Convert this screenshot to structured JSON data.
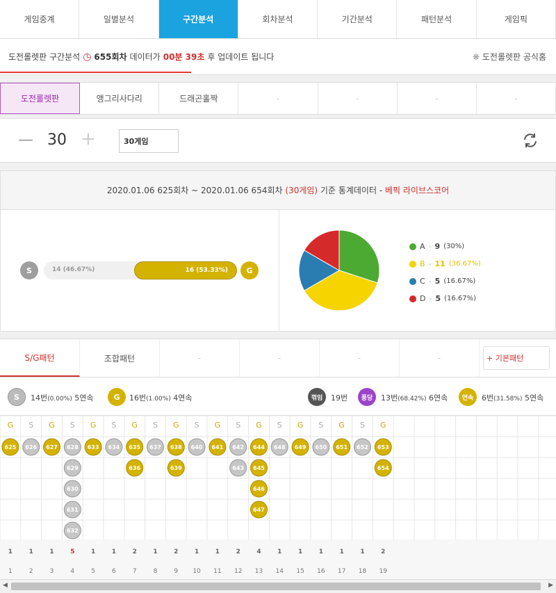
{
  "tabs": [
    "게임중계",
    "일별분석",
    "구간분석",
    "회차분석",
    "기간분석",
    "패턴분석",
    "게임픽"
  ],
  "info": {
    "prefix": "도전롤렛판 구간분석",
    "round": "655회차",
    "mid": "데이터가",
    "time": "00분 39초",
    "suffix": "후 업데이트 됩니다",
    "home": "도전롤렛판 공식홈"
  },
  "subtabs": [
    "도전롤렛판",
    "앵그리사다리",
    "드래곤홀짝",
    "-",
    "-",
    "-",
    "-"
  ],
  "control": {
    "minus": "—",
    "value": "30",
    "plus": "+",
    "select": "30게임"
  },
  "header": {
    "range": "2020.01.06 625회차 ~ 2020.01.06 654회차",
    "games": "(30게임)",
    "mid": "기준 통계데이터 -",
    "brand": "베픽 라이브스코어"
  },
  "sg": {
    "s_label": "S",
    "g_label": "G",
    "s_text": "14 (46.67%)",
    "g_text": "16 (53.33%)",
    "g_pct": 53.33
  },
  "pie": [
    {
      "name": "A",
      "count": "9",
      "pct": "(30%)",
      "value": 9,
      "color": "#4caa32"
    },
    {
      "name": "B",
      "count": "11",
      "pct": "(36.67%)",
      "value": 11,
      "color": "#f5d400"
    },
    {
      "name": "C",
      "count": "5",
      "pct": "(16.67%)",
      "value": 5,
      "color": "#2a7db0"
    },
    {
      "name": "D",
      "count": "5",
      "pct": "(16.67%)",
      "value": 5,
      "color": "#d52a2a"
    }
  ],
  "ptabs": [
    "S/G패턴",
    "조합패턴",
    "-",
    "-",
    "-",
    "-"
  ],
  "basic_btn": "+ 기본패턴",
  "summary": {
    "s_circle": "S",
    "s_text": "14번",
    "s_pct": "(0.00%)",
    "s_streak": "5연속",
    "g_circle": "G",
    "g_text": "16번",
    "g_pct": "(1.00%)",
    "g_streak": "4연속",
    "k_circle": "꺾임",
    "k_text": "19번",
    "p_circle": "퐁당",
    "p_text": "13번",
    "p_pct": "(68.42%)",
    "p_streak": "6연속",
    "y_circle": "연속",
    "y_text": "6번",
    "y_pct": "(31.58%)",
    "y_streak": "5연속"
  },
  "columns": [
    {
      "h": "G",
      "rounds": [
        "625"
      ],
      "cnt": "1"
    },
    {
      "h": "S",
      "rounds": [
        "626"
      ],
      "cnt": "1"
    },
    {
      "h": "G",
      "rounds": [
        "627"
      ],
      "cnt": "1"
    },
    {
      "h": "S",
      "rounds": [
        "628",
        "629",
        "630",
        "631",
        "632"
      ],
      "cnt": "5"
    },
    {
      "h": "G",
      "rounds": [
        "633"
      ],
      "cnt": "1"
    },
    {
      "h": "S",
      "rounds": [
        "634"
      ],
      "cnt": "1"
    },
    {
      "h": "G",
      "rounds": [
        "635",
        "636"
      ],
      "cnt": "2"
    },
    {
      "h": "S",
      "rounds": [
        "637"
      ],
      "cnt": "1"
    },
    {
      "h": "G",
      "rounds": [
        "638",
        "639"
      ],
      "cnt": "2"
    },
    {
      "h": "S",
      "rounds": [
        "640"
      ],
      "cnt": "1"
    },
    {
      "h": "G",
      "rounds": [
        "641"
      ],
      "cnt": "1"
    },
    {
      "h": "S",
      "rounds": [
        "642",
        "643"
      ],
      "cnt": "2"
    },
    {
      "h": "G",
      "rounds": [
        "644",
        "645",
        "646",
        "647"
      ],
      "cnt": "4"
    },
    {
      "h": "S",
      "rounds": [
        "648"
      ],
      "cnt": "1"
    },
    {
      "h": "G",
      "rounds": [
        "649"
      ],
      "cnt": "1"
    },
    {
      "h": "S",
      "rounds": [
        "650"
      ],
      "cnt": "1"
    },
    {
      "h": "G",
      "rounds": [
        "651"
      ],
      "cnt": "1"
    },
    {
      "h": "S",
      "rounds": [
        "652"
      ],
      "cnt": "1"
    },
    {
      "h": "G",
      "rounds": [
        "653",
        "654"
      ],
      "cnt": "2"
    }
  ],
  "colors": {
    "gold": "#d4b200",
    "gray": "#bdbdbd",
    "red": "#d0312d",
    "blue": "#1aa3de"
  }
}
